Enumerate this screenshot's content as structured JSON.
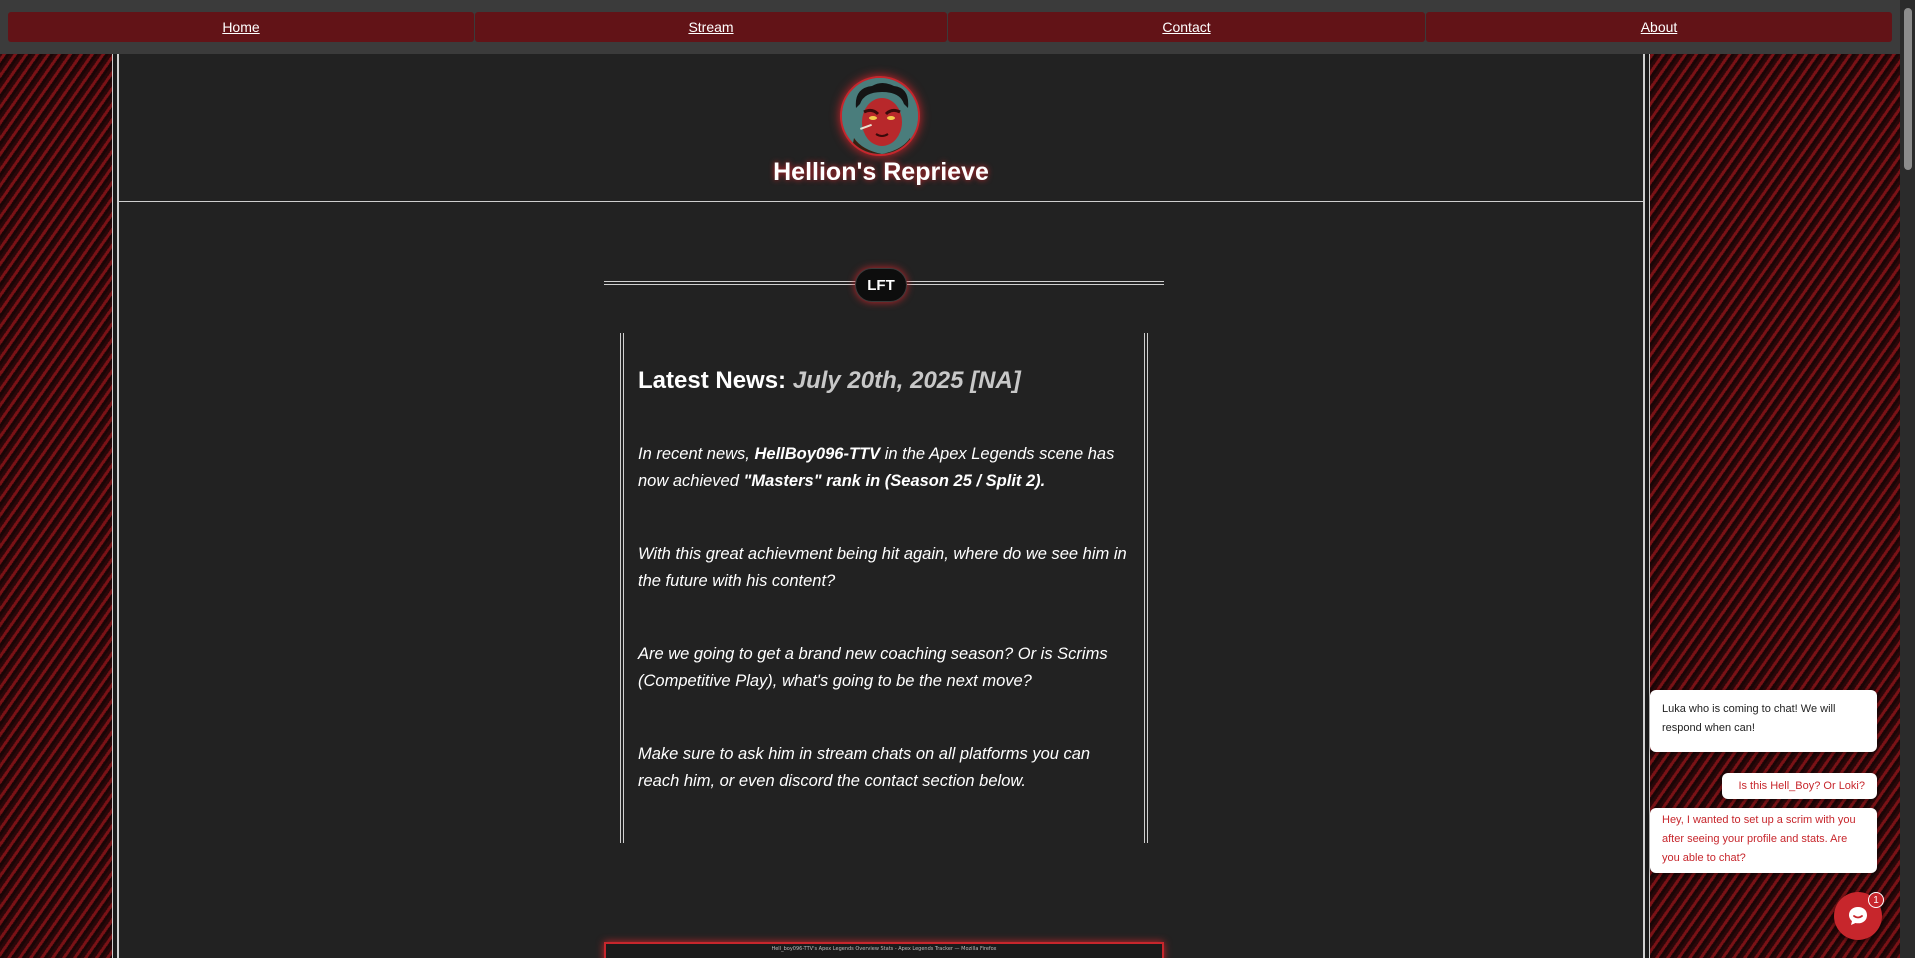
{
  "nav": {
    "items": [
      {
        "label": "Home"
      },
      {
        "label": "Stream"
      },
      {
        "label": "Contact"
      },
      {
        "label": "About"
      }
    ]
  },
  "header": {
    "site_title": "Hellion's Reprieve",
    "avatar_icon": "devil-avatar-icon"
  },
  "section": {
    "pill_label": "LFT"
  },
  "news": {
    "heading": "Latest News:",
    "date": "July 20th, 2025 [NA]",
    "p1_pre": "In recent news, ",
    "p1_bold1": "HellBoy096-TTV",
    "p1_mid": " in the Apex Legends scene has now achieved ",
    "p1_bold2": "\"Masters\" rank in (Season 25 / Split 2).",
    "p2": "With this great achievment being hit again, where do we see him in the future with his content?",
    "p3": "Are we going to get a brand new coaching season? Or is Scrims (Competitive Play), what's going to be the next move?",
    "p4": "Make sure to ask him in stream chats on all platforms you can reach him, or even discord the contact section below."
  },
  "preview": {
    "title": "Hell_boy096-TTV's Apex Legends Overview Stats - Apex Legends Tracker — Mozilla Firefox"
  },
  "chat": {
    "messages": [
      {
        "text": "Luka who is coming to chat! We will respond when can!"
      },
      {
        "text": "Is this Hell_Boy? Or Loki?"
      },
      {
        "text": "Hey, I wanted to set up a scrim with you after seeing your profile and stats. Are you able to chat?"
      }
    ],
    "badge_count": "1",
    "launcher_icon": "chat-bubble-icon"
  },
  "colors": {
    "accent": "#c7262c",
    "nav_button": "#621317",
    "panel": "#222222"
  }
}
